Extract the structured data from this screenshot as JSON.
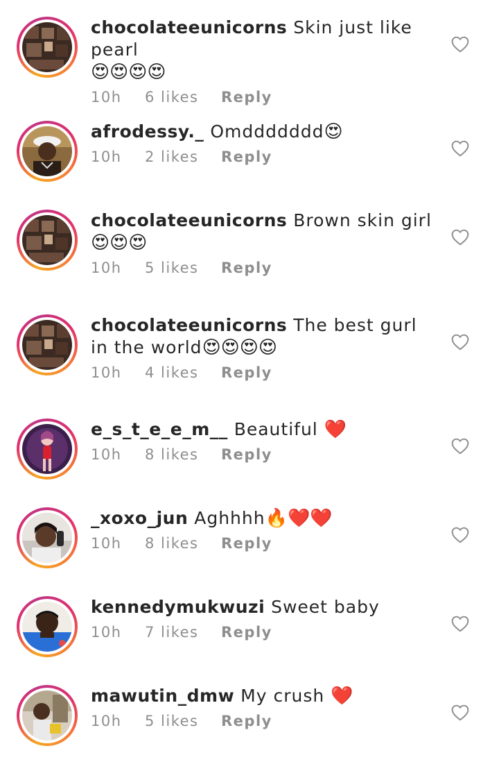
{
  "comments": [
    {
      "username": "chocolateeunicorns",
      "text": "Skin just like pearl",
      "emoji": "😍😍😍😍",
      "time": "10h",
      "likes": "6 likes",
      "reply": "Reply",
      "avatar": "dark-collage"
    },
    {
      "username": "afrodessy._",
      "text": "Omddddddd",
      "emoji": "😍",
      "time": "10h",
      "likes": "2 likes",
      "reply": "Reply",
      "avatar": "person-white-cap"
    },
    {
      "username": "chocolateeunicorns",
      "text": "Brown skin girl",
      "emoji": "😍😍😍",
      "time": "10h",
      "likes": "5 likes",
      "reply": "Reply",
      "avatar": "dark-collage"
    },
    {
      "username": "chocolateeunicorns",
      "text": "The best gurl in the world",
      "emoji": "😍😍😍😍",
      "time": "10h",
      "likes": "4 likes",
      "reply": "Reply",
      "avatar": "dark-collage"
    },
    {
      "username": "e_s_t_e_e_m__",
      "text": "Beautiful",
      "emoji": "❤️",
      "time": "10h",
      "likes": "8 likes",
      "reply": "Reply",
      "avatar": "anime-figure"
    },
    {
      "username": "_xoxo_jun",
      "text": "Aghhhh",
      "emoji": "🔥❤️❤️",
      "time": "10h",
      "likes": "8 likes",
      "reply": "Reply",
      "avatar": "selfie-girl"
    },
    {
      "username": "kennedymukwuzi",
      "text": "Sweet baby",
      "emoji": "",
      "time": "10h",
      "likes": "7 likes",
      "reply": "Reply",
      "avatar": "boy-portrait"
    },
    {
      "username": "mawutin_dmw",
      "text": "My crush",
      "emoji": "❤️",
      "time": "10h",
      "likes": "5 likes",
      "reply": "Reply",
      "avatar": "child-shop"
    }
  ],
  "icons": {
    "like": "heart-outline-icon"
  },
  "colors": {
    "ring_start": "#f5a623",
    "ring_mid": "#e1306c",
    "meta": "#8e8e8e",
    "text": "#262626"
  }
}
